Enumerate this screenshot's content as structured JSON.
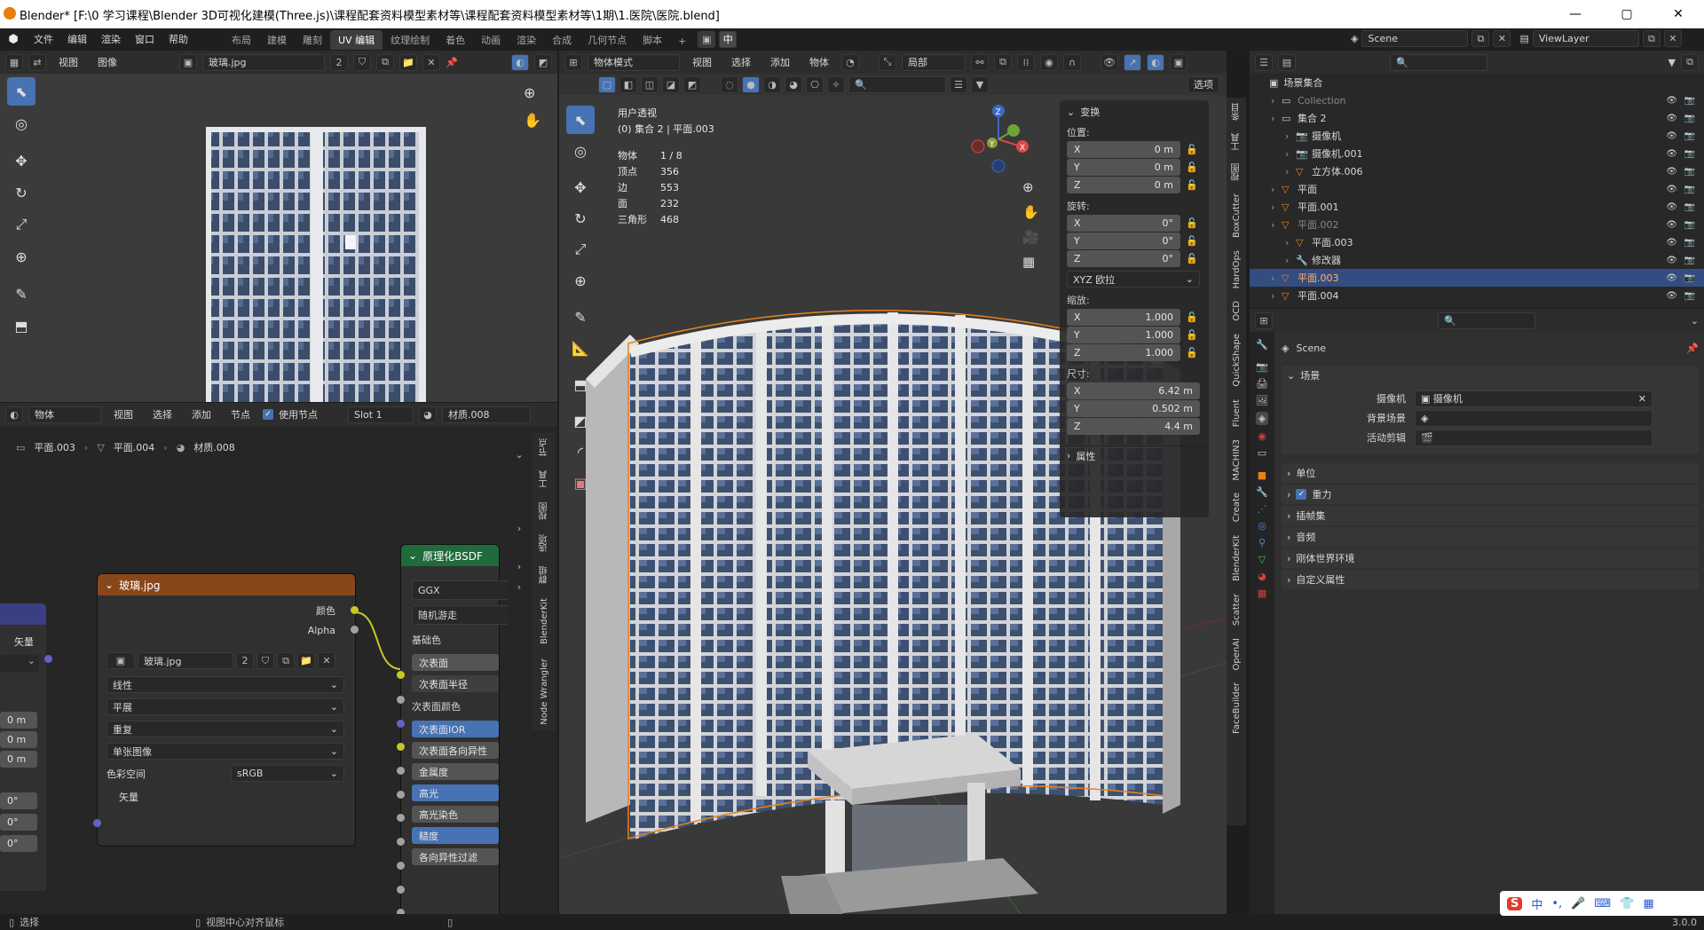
{
  "window": {
    "title": "Blender* [F:\\0 学习课程\\Blender 3D可视化建模(Three.js)\\课程配套资料模型素材等\\课程配套资料模型素材等\\1期\\1.医院\\医院.blend]",
    "minimize": "—",
    "maximize": "▢",
    "close": "✕"
  },
  "topmenu": [
    "文件",
    "编辑",
    "渲染",
    "窗口",
    "帮助"
  ],
  "workspaces": [
    "布局",
    "建模",
    "雕刻",
    "UV 编辑",
    "纹理绘制",
    "着色",
    "动画",
    "渲染",
    "合成",
    "几何节点",
    "脚本"
  ],
  "active_workspace": "UV 编辑",
  "scene_name": "Scene",
  "viewlayer_name": "ViewLayer",
  "lang_badge": "中",
  "uv_editor": {
    "menus": [
      "视图",
      "图像"
    ],
    "image_name": "玻璃.jpg",
    "user_count": "2"
  },
  "node_editor": {
    "mode": "物体",
    "menus": [
      "视图",
      "选择",
      "添加",
      "节点"
    ],
    "use_nodes_label": "使用节点",
    "slot": "Slot 1",
    "material": "材质.008",
    "breadcrumb": [
      "平面.003",
      "平面.004",
      "材质.008"
    ],
    "side_tabs": [
      "节点",
      "工具",
      "视图",
      "选项",
      "群组",
      "BlenderKit",
      "Node Wrangler"
    ],
    "left_node": {
      "vector_label": "矢量",
      "values_loc": [
        "0 m",
        "0 m",
        "0 m"
      ],
      "values_rot": [
        "0°",
        "0°",
        "0°"
      ]
    },
    "image_node": {
      "title": "玻璃.jpg",
      "out_color": "颜色",
      "out_alpha": "Alpha",
      "image_name": "玻璃.jpg",
      "user_count": "2",
      "interpolation": "线性",
      "projection": "平展",
      "extension": "重复",
      "source": "单张图像",
      "colorspace_label": "色彩空间",
      "colorspace": "sRGB",
      "vector_in": "矢量"
    },
    "bsdf_node": {
      "title": "原理化BSDF",
      "distribution": "GGX",
      "subsurface_method": "随机游走",
      "inputs": [
        "基础色",
        "次表面",
        "次表面半径",
        "次表面颜色",
        "次表面IOR",
        "次表面各向异性",
        "金属度",
        "高光",
        "高光染色",
        "糙度",
        "各向异性过滤"
      ]
    }
  },
  "viewport": {
    "mode": "物体模式",
    "menus": [
      "视图",
      "选择",
      "添加",
      "物体"
    ],
    "transform_orient": "局部",
    "options_label": "选项",
    "view_name": "用户透视",
    "context": "(0) 集合 2 | 平面.003",
    "stats": [
      {
        "k": "物体",
        "v": "1 / 8"
      },
      {
        "k": "顶点",
        "v": "356"
      },
      {
        "k": "边",
        "v": "553"
      },
      {
        "k": "面",
        "v": "232"
      },
      {
        "k": "三角形",
        "v": "468"
      }
    ],
    "gizmo_axes": {
      "x": "X",
      "y": "Y",
      "z": "Z"
    },
    "npanel": {
      "title": "变换",
      "location_label": "位置:",
      "location": [
        {
          "a": "X",
          "v": "0 m"
        },
        {
          "a": "Y",
          "v": "0 m"
        },
        {
          "a": "Z",
          "v": "0 m"
        }
      ],
      "rotation_label": "旋转:",
      "rotation": [
        {
          "a": "X",
          "v": "0°"
        },
        {
          "a": "Y",
          "v": "0°"
        },
        {
          "a": "Z",
          "v": "0°"
        }
      ],
      "rotation_mode": "XYZ 欧拉",
      "scale_label": "缩放:",
      "scale": [
        {
          "a": "X",
          "v": "1.000"
        },
        {
          "a": "Y",
          "v": "1.000"
        },
        {
          "a": "Z",
          "v": "1.000"
        }
      ],
      "dims_label": "尺寸:",
      "dims": [
        {
          "a": "X",
          "v": "6.42 m"
        },
        {
          "a": "Y",
          "v": "0.502 m"
        },
        {
          "a": "Z",
          "v": "4.4 m"
        }
      ],
      "properties_label": "属性"
    },
    "side_tabs": [
      "条目",
      "工具",
      "视图",
      "BoxCutter",
      "HardOps",
      "OCD",
      "QuickShape",
      "Fluent",
      "MACHIN3",
      "Create",
      "BlenderKit",
      "Scatter",
      "OpenAI",
      "FaceBuilder"
    ]
  },
  "outliner": {
    "root": "场景集合",
    "items": [
      {
        "name": "Collection",
        "indent": 1,
        "dim": true
      },
      {
        "name": "集合 2",
        "indent": 1
      },
      {
        "name": "摄像机",
        "indent": 2
      },
      {
        "name": "摄像机.001",
        "indent": 2
      },
      {
        "name": "立方体.006",
        "indent": 2
      },
      {
        "name": "平面",
        "indent": 1
      },
      {
        "name": "平面.001",
        "indent": 1
      },
      {
        "name": "平面.002",
        "indent": 1,
        "dim": true
      },
      {
        "name": "平面.003",
        "indent": 2
      },
      {
        "name": "修改器",
        "indent": 2
      },
      {
        "name": "平面.003",
        "indent": 1,
        "sel": true
      },
      {
        "name": "平面.004",
        "indent": 1
      }
    ]
  },
  "properties": {
    "header": "Scene",
    "section": "场景",
    "camera_label": "摄像机",
    "camera_value": "摄像机",
    "bg_scene_label": "背景场景",
    "active_clip_label": "活动剪辑",
    "panels": [
      "单位",
      "重力",
      "插帧集",
      "音频",
      "刚体世界环境",
      "自定义属性"
    ]
  },
  "statusbar": {
    "left": "选择",
    "middle": "视图中心对齐鼠标",
    "version": "3.0.0"
  }
}
